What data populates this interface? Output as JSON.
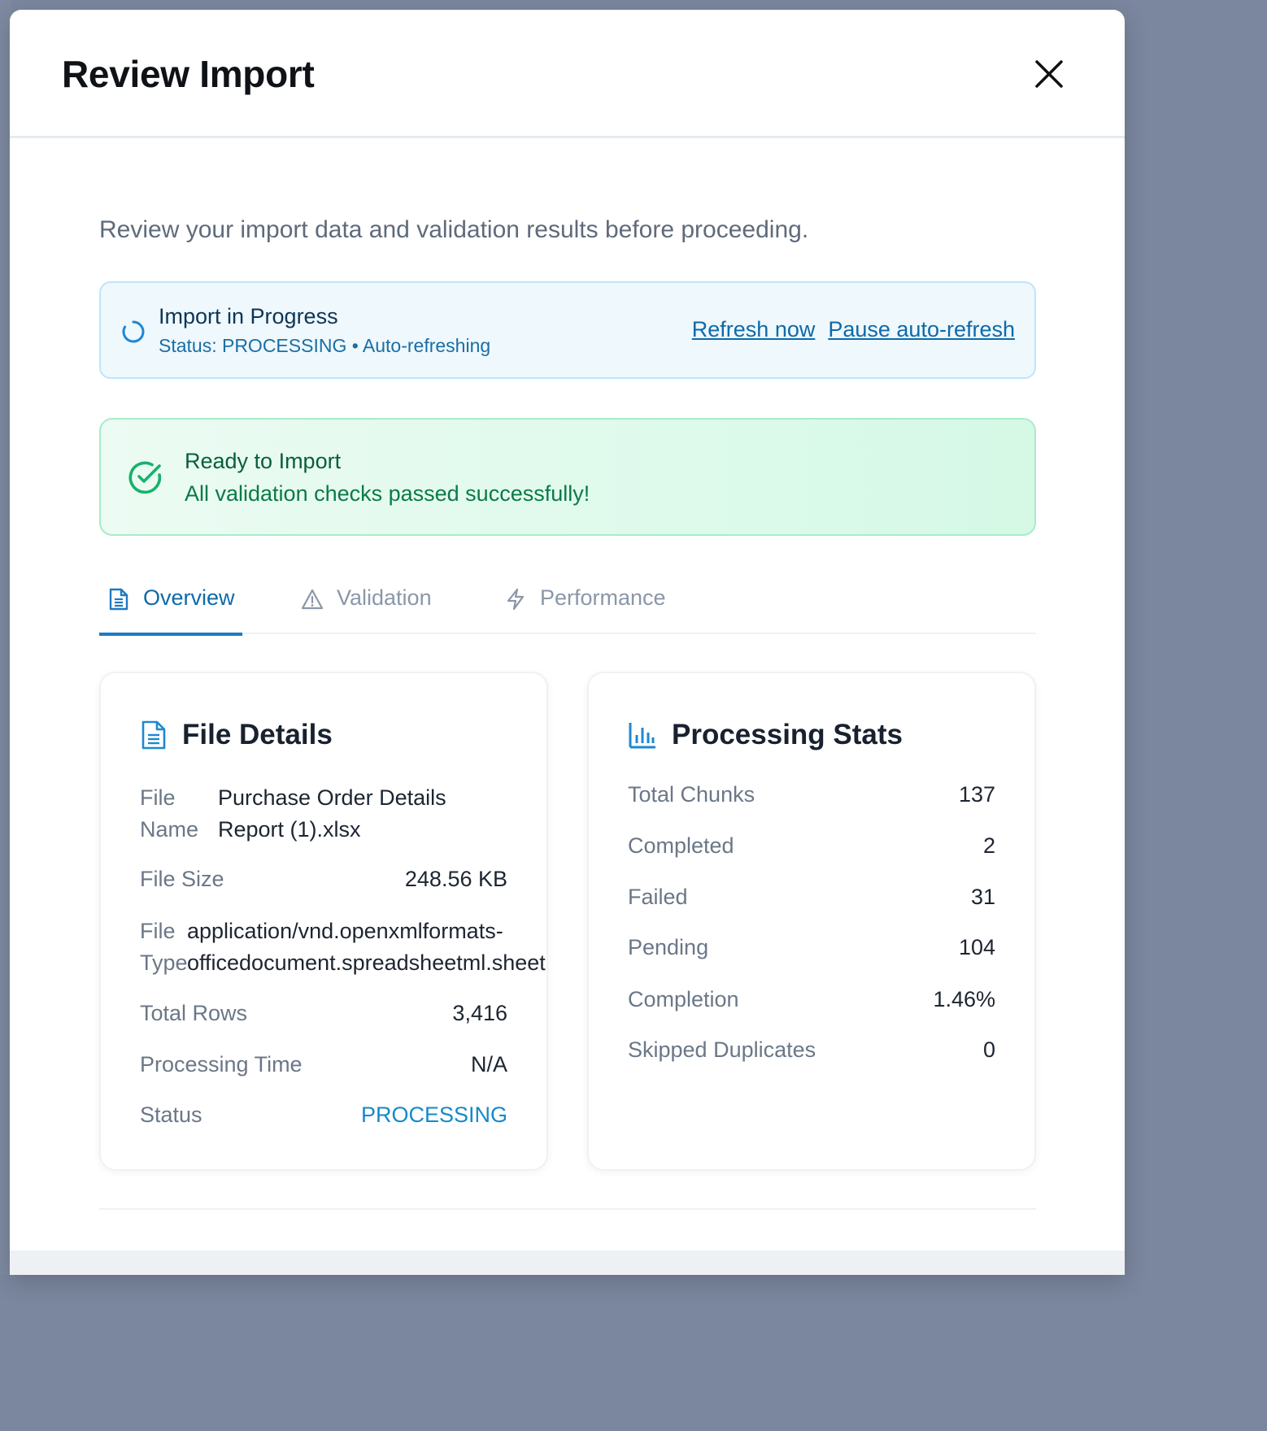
{
  "modal": {
    "title": "Review Import",
    "subtitle": "Review your import data and validation results before proceeding."
  },
  "progress": {
    "title": "Import in Progress",
    "status": "Status: PROCESSING • Auto-refreshing",
    "refresh_link": "Refresh now",
    "pause_link": "Pause auto-refresh"
  },
  "ready": {
    "title": "Ready to Import",
    "message": "All validation checks passed successfully!"
  },
  "tabs": [
    {
      "label": "Overview",
      "icon": "document-icon",
      "active": true
    },
    {
      "label": "Validation",
      "icon": "warning-icon",
      "active": false
    },
    {
      "label": "Performance",
      "icon": "lightning-icon",
      "active": false
    }
  ],
  "file_details": {
    "title": "File Details",
    "rows": [
      {
        "key_line1": "File",
        "key_line2": "Name",
        "value_line1": "Purchase Order Details",
        "value_line2": "Report (1).xlsx"
      },
      {
        "key": "File Size",
        "value": "248.56 KB"
      },
      {
        "key_line1": "File",
        "key_line2": "Type",
        "value_line1": "application/vnd.openxmlformats-",
        "value_line2": "officedocument.spreadsheetml.sheet"
      },
      {
        "key": "Total Rows",
        "value": "3,416"
      },
      {
        "key": "Processing Time",
        "value": "N/A"
      },
      {
        "key": "Status",
        "value": "PROCESSING"
      }
    ]
  },
  "processing_stats": {
    "title": "Processing Stats",
    "rows": [
      {
        "key": "Total Chunks",
        "value": "137"
      },
      {
        "key": "Completed",
        "value": "2"
      },
      {
        "key": "Failed",
        "value": "31"
      },
      {
        "key": "Pending",
        "value": "104"
      },
      {
        "key": "Completion",
        "value": "1.46%"
      },
      {
        "key": "Skipped Duplicates",
        "value": "0"
      }
    ]
  },
  "colors": {
    "accent": "#1e7ac2",
    "success": "#0b7a48",
    "status_processing": "#1689c9"
  }
}
